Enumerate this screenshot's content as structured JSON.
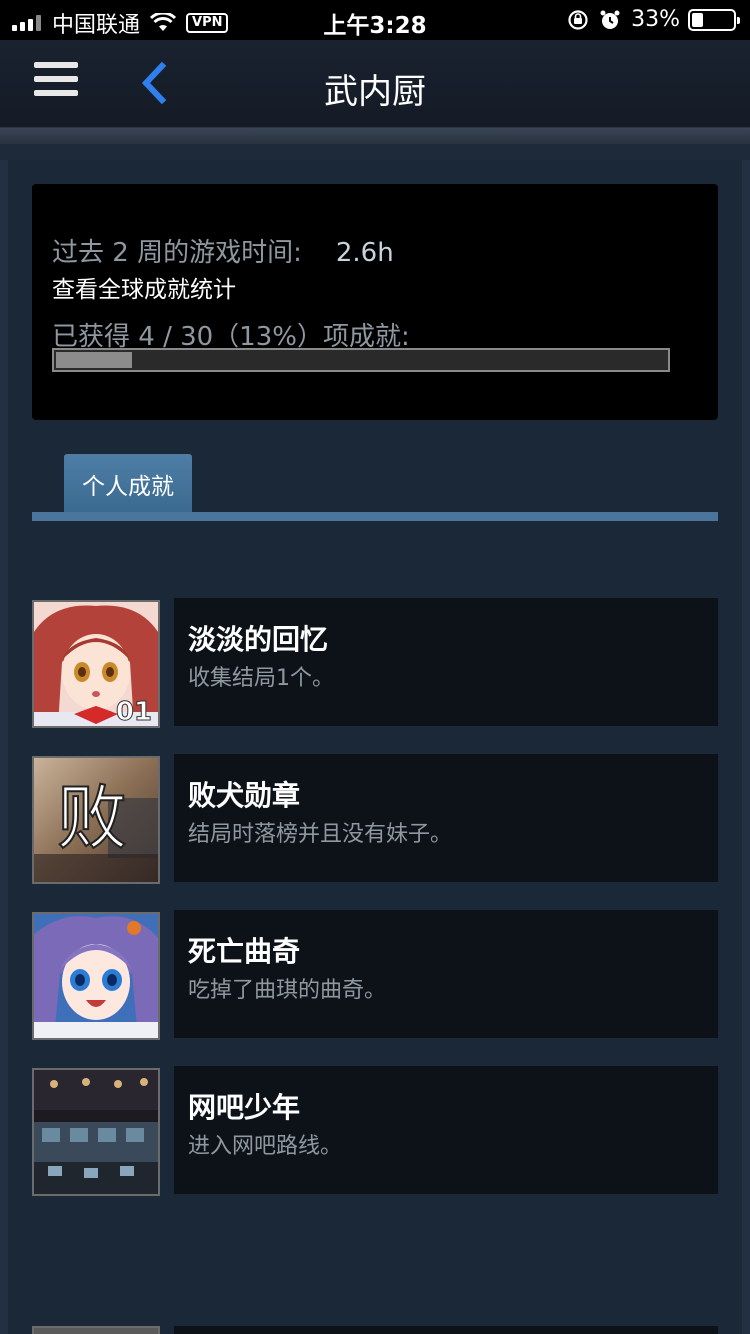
{
  "status_bar": {
    "carrier": "中国联通",
    "vpn": "VPN",
    "time": "上午3:28",
    "battery": "33%",
    "battery_level": 0.33
  },
  "header": {
    "title": "武内厨",
    "menu_icon": "hamburger-icon",
    "back_icon": "chevron-left-icon"
  },
  "summary": {
    "playtime_label": "过去 2 周的游戏时间:",
    "playtime_value": "2.6h",
    "global_stats_link": "查看全球成就统计",
    "earned_text": "已获得 4 / 30（13%）项成就:",
    "progress_fraction": 0.13
  },
  "tabs": [
    {
      "label": "个人成就",
      "active": true
    }
  ],
  "achievements": [
    {
      "name": "淡淡的回忆",
      "description": "收集结局1个。",
      "icon": "anime-girl-red-hair-portrait",
      "badge": "01"
    },
    {
      "name": "败犬勋章",
      "description": "结局时落榜并且没有妹子。",
      "icon": "defeat-character-badge",
      "glyph": "败"
    },
    {
      "name": "死亡曲奇",
      "description": "吃掉了曲琪的曲奇。",
      "icon": "anime-girl-purple-hair-portrait"
    },
    {
      "name": "网吧少年",
      "description": "进入网吧路线。",
      "icon": "internet-cafe-scene"
    }
  ],
  "colors": {
    "accent_blue": "#2f80ed",
    "tab_blue": "#4b759a",
    "background": "#1b2838"
  }
}
